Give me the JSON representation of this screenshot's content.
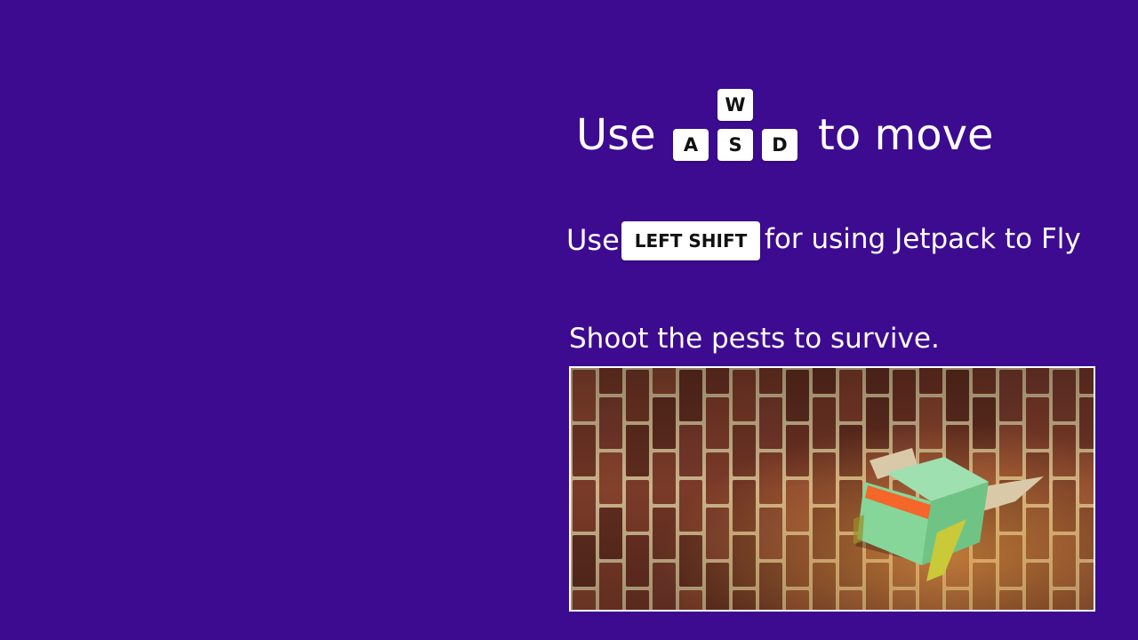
{
  "move": {
    "prefix": "Use",
    "suffix": "to move",
    "keys": {
      "up": "W",
      "left": "A",
      "down": "S",
      "right": "D"
    }
  },
  "jetpack": {
    "prefix": "Use",
    "key": "LEFT SHIFT",
    "suffix": "for using Jetpack to Fly"
  },
  "shoot": {
    "text": "Shoot the pests to survive."
  },
  "colors": {
    "background": "#3d0b8f",
    "key_background": "#ffffff",
    "key_text": "#111111",
    "text": "#ffffff",
    "pest_body": "#86d69a",
    "pest_stripe": "#f4662a",
    "pest_wings": "#d9c9a8",
    "bricks": "#6e3424"
  },
  "screenshot": {
    "scene": "brick-wall-with-flying-pest"
  }
}
